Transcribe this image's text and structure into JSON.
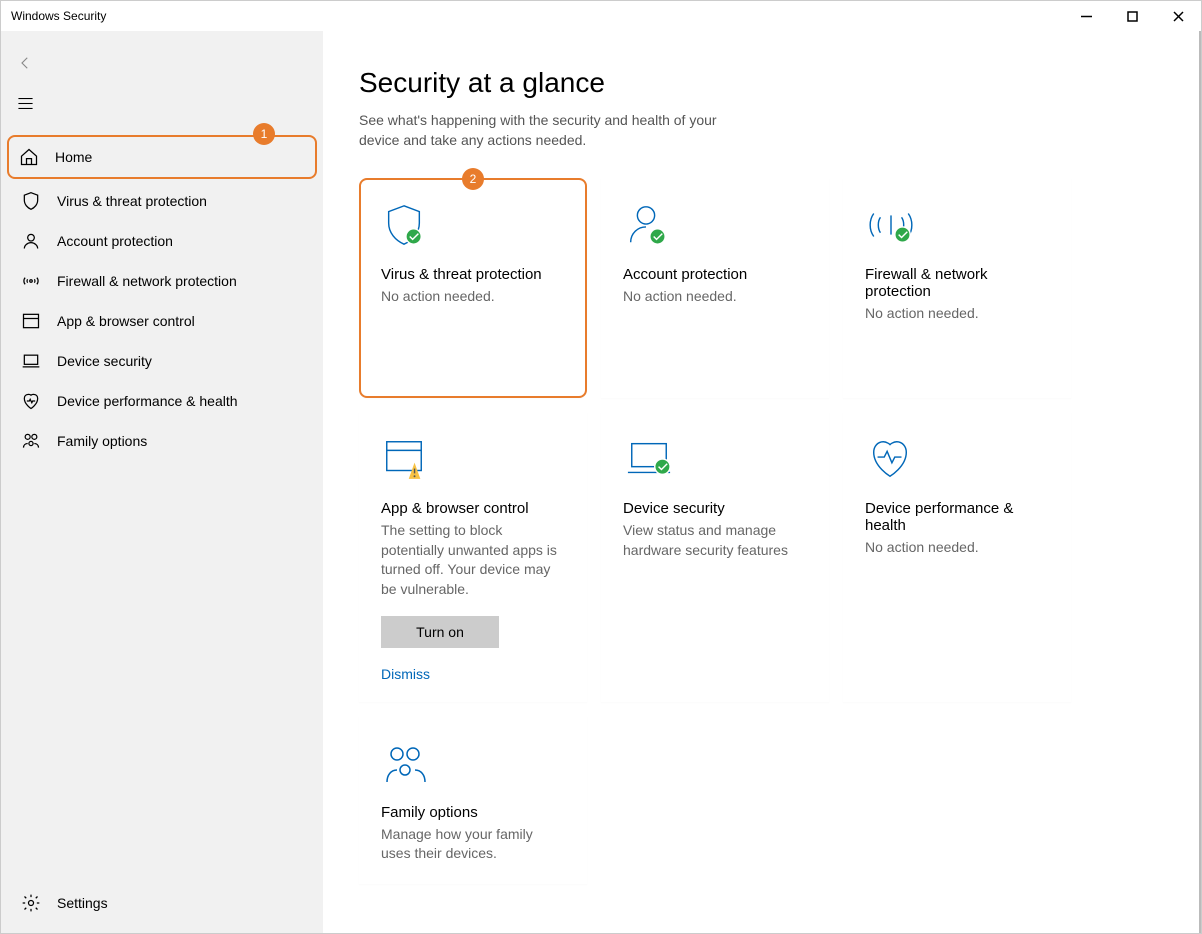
{
  "window": {
    "title": "Windows Security"
  },
  "annotations": {
    "home_badge": "1",
    "virus_tile_badge": "2"
  },
  "sidebar": {
    "home": "Home",
    "virus": "Virus & threat protection",
    "account": "Account protection",
    "firewall": "Firewall & network protection",
    "appbrowser": "App & browser control",
    "device": "Device security",
    "performance": "Device performance & health",
    "family": "Family options",
    "settings": "Settings"
  },
  "page": {
    "title": "Security at a glance",
    "subtitle": "See what's happening with the security and health of your device and take any actions needed."
  },
  "tiles": {
    "virus": {
      "title": "Virus & threat protection",
      "desc": "No action needed."
    },
    "account": {
      "title": "Account protection",
      "desc": "No action needed."
    },
    "firewall": {
      "title": "Firewall & network protection",
      "desc": "No action needed."
    },
    "appbrowser": {
      "title": "App & browser control",
      "desc": "The setting to block potentially unwanted apps is turned off. Your device may be vulnerable.",
      "button": "Turn on",
      "dismiss": "Dismiss"
    },
    "device": {
      "title": "Device security",
      "desc": "View status and manage hardware security features"
    },
    "performance": {
      "title": "Device performance & health",
      "desc": "No action needed."
    },
    "family": {
      "title": "Family options",
      "desc": "Manage how your family uses their devices."
    }
  }
}
